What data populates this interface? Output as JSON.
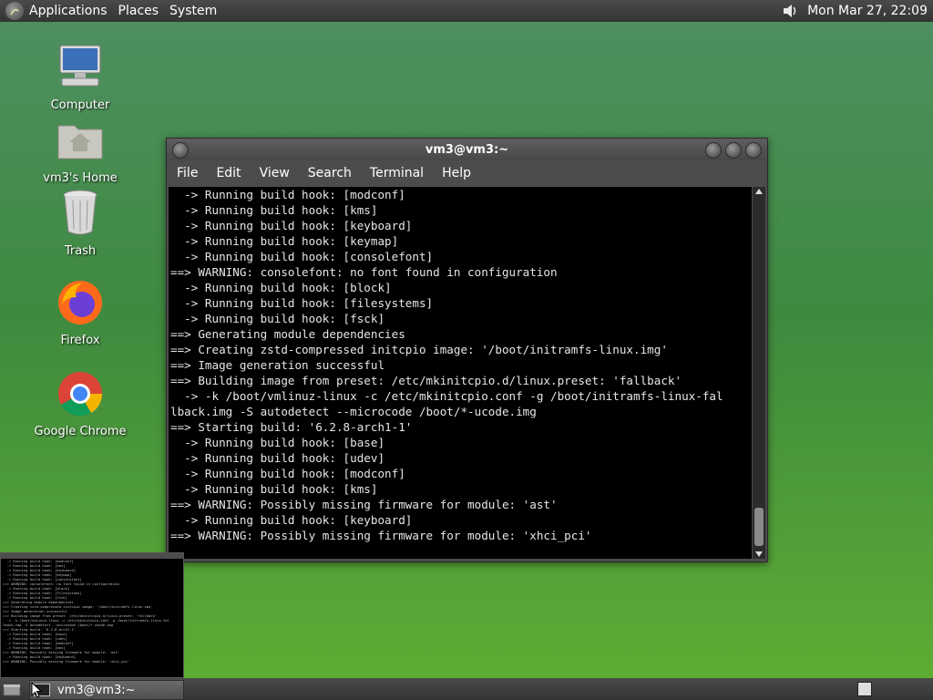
{
  "top_panel": {
    "menus": [
      "Applications",
      "Places",
      "System"
    ],
    "clock": "Mon Mar 27, 22:09"
  },
  "desktop_icons": {
    "computer": "Computer",
    "home": "vm3's Home",
    "trash": "Trash",
    "firefox": "Firefox",
    "chrome": "Google Chrome"
  },
  "terminal": {
    "title": "vm3@vm3:~",
    "menu": [
      "File",
      "Edit",
      "View",
      "Search",
      "Terminal",
      "Help"
    ],
    "lines": [
      "  -> Running build hook: [modconf]",
      "  -> Running build hook: [kms]",
      "  -> Running build hook: [keyboard]",
      "  -> Running build hook: [keymap]",
      "  -> Running build hook: [consolefont]",
      "==> WARNING: consolefont: no font found in configuration",
      "  -> Running build hook: [block]",
      "  -> Running build hook: [filesystems]",
      "  -> Running build hook: [fsck]",
      "==> Generating module dependencies",
      "==> Creating zstd-compressed initcpio image: '/boot/initramfs-linux.img'",
      "==> Image generation successful",
      "==> Building image from preset: /etc/mkinitcpio.d/linux.preset: 'fallback'",
      "  -> -k /boot/vmlinuz-linux -c /etc/mkinitcpio.conf -g /boot/initramfs-linux-fal",
      "lback.img -S autodetect --microcode /boot/*-ucode.img",
      "==> Starting build: '6.2.8-arch1-1'",
      "  -> Running build hook: [base]",
      "  -> Running build hook: [udev]",
      "  -> Running build hook: [modconf]",
      "  -> Running build hook: [kms]",
      "==> WARNING: Possibly missing firmware for module: 'ast'",
      "  -> Running build hook: [keyboard]",
      "==> WARNING: Possibly missing firmware for module: 'xhci_pci'"
    ]
  },
  "taskbar": {
    "task_title": "vm3@vm3:~"
  },
  "colors": {
    "terminal_bg": "#000000",
    "terminal_fg": "#e6e6e6",
    "panel": "#3c3c3c"
  }
}
